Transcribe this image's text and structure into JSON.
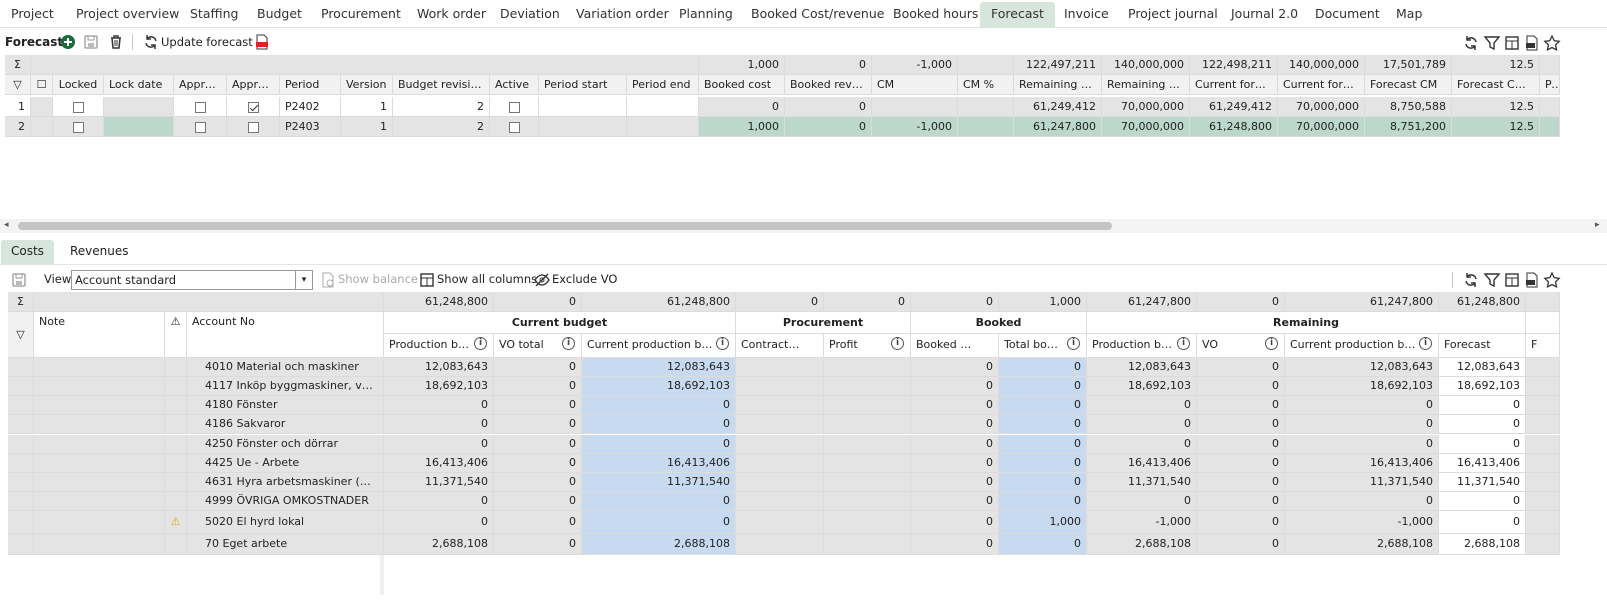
{
  "tabs": [
    "Project",
    "Project overview",
    "Staffing",
    "Budget",
    "Procurement",
    "Work order",
    "Deviation",
    "Variation order",
    "Planning",
    "Booked Cost/revenue",
    "Booked hours",
    "Forecast",
    "Invoice",
    "Project journal",
    "Journal 2.0",
    "Document",
    "Map"
  ],
  "active_tab": "Forecast",
  "forecast_toolbar": {
    "title": "Forecast",
    "update_label": "Update forecast"
  },
  "forecast_grid": {
    "totals": [
      "1,000",
      "0",
      "-1,000",
      "",
      "122,497,211",
      "140,000,000",
      "122,498,211",
      "140,000,000",
      "17,501,789",
      "12.5"
    ],
    "headers": [
      "Locked",
      "Lock date",
      "Appro...",
      "Appro...",
      "Period",
      "Version",
      "Budget revision",
      "Active",
      "Period start",
      "Period end",
      "Booked cost",
      "Booked reven...",
      "CM",
      "CM %",
      "Remaining cost",
      "Remaining rev...",
      "Current forec...",
      "Current forec...",
      "Forecast CM",
      "Forecast CM %",
      "Pe"
    ],
    "rows": [
      {
        "num": "1",
        "locked": false,
        "appr1": false,
        "appr2": true,
        "period": "P2402",
        "version": "1",
        "revision": "2",
        "active": false,
        "booked_cost": "0",
        "booked_rev": "0",
        "cm": "",
        "cm_pct": "",
        "rem_cost": "61,249,412",
        "rem_rev": "70,000,000",
        "cur_f1": "61,249,412",
        "cur_f2": "70,000,000",
        "f_cm": "8,750,588",
        "f_cm_pct": "12.5"
      },
      {
        "num": "2",
        "locked": false,
        "appr1": false,
        "appr2": false,
        "period": "P2403",
        "version": "1",
        "revision": "2",
        "active": false,
        "booked_cost": "1,000",
        "booked_rev": "0",
        "cm": "-1,000",
        "cm_pct": "",
        "rem_cost": "61,247,800",
        "rem_rev": "70,000,000",
        "cur_f1": "61,248,800",
        "cur_f2": "70,000,000",
        "f_cm": "8,751,200",
        "f_cm_pct": "12.5"
      }
    ]
  },
  "sub_tabs": [
    "Costs",
    "Revenues"
  ],
  "costs_toolbar": {
    "view_label": "View:",
    "view_value": "Account standard",
    "show_balance": "Show balance",
    "show_all_columns": "Show all columns",
    "exclude_vo": "Exclude VO"
  },
  "costs_grid": {
    "totals": [
      "61,248,800",
      "0",
      "61,248,800",
      "0",
      "0",
      "0",
      "1,000",
      "61,247,800",
      "0",
      "61,247,800",
      "61,248,800"
    ],
    "left_headers": {
      "note": "Note",
      "account": "Account No"
    },
    "groups": [
      "Current budget",
      "Procurement",
      "Booked",
      "Remaining"
    ],
    "headers": [
      "Production bu...",
      "VO total",
      "Current production bud...",
      "Contract ...",
      "Profit",
      "Booked VO",
      "Total book...",
      "Production bu...",
      "VO",
      "Current production bud...",
      "Forecast",
      "Forec"
    ],
    "rows": [
      {
        "warn": false,
        "account": "4010 Material och maskiner",
        "v": [
          "12,083,643",
          "0",
          "12,083,643",
          "",
          "",
          "0",
          "0",
          "12,083,643",
          "0",
          "12,083,643",
          "12,083,643"
        ]
      },
      {
        "warn": false,
        "account": "4117 Inköp byggmaskiner, ver...",
        "v": [
          "18,692,103",
          "0",
          "18,692,103",
          "",
          "",
          "0",
          "0",
          "18,692,103",
          "0",
          "18,692,103",
          "18,692,103"
        ]
      },
      {
        "warn": false,
        "account": "4180 Fönster",
        "v": [
          "0",
          "0",
          "0",
          "",
          "",
          "0",
          "0",
          "0",
          "0",
          "0",
          "0"
        ]
      },
      {
        "warn": false,
        "account": "4186 Sakvaror",
        "v": [
          "0",
          "0",
          "0",
          "",
          "",
          "0",
          "0",
          "0",
          "0",
          "0",
          "0"
        ]
      },
      {
        "warn": false,
        "account": "4250 Fönster och dörrar",
        "v": [
          "0",
          "0",
          "0",
          "",
          "",
          "0",
          "0",
          "0",
          "0",
          "0",
          "0"
        ]
      },
      {
        "warn": false,
        "account": "4425 Ue - Arbete",
        "v": [
          "16,413,406",
          "0",
          "16,413,406",
          "",
          "",
          "0",
          "0",
          "16,413,406",
          "0",
          "16,413,406",
          "16,413,406"
        ]
      },
      {
        "warn": false,
        "account": "4631 Hyra arbetsmaskiner (m...",
        "v": [
          "11,371,540",
          "0",
          "11,371,540",
          "",
          "",
          "0",
          "0",
          "11,371,540",
          "0",
          "11,371,540",
          "11,371,540"
        ]
      },
      {
        "warn": false,
        "account": "4999 ÖVRIGA OMKOSTNADER",
        "v": [
          "0",
          "0",
          "0",
          "",
          "",
          "0",
          "0",
          "0",
          "0",
          "0",
          "0"
        ]
      },
      {
        "warn": true,
        "account": "5020 El hyrd lokal",
        "v": [
          "0",
          "0",
          "0",
          "",
          "",
          "0",
          "1,000",
          "-1,000",
          "0",
          "-1,000",
          "0"
        ]
      },
      {
        "warn": false,
        "account": "70 Eget arbete",
        "v": [
          "2,688,108",
          "0",
          "2,688,108",
          "",
          "",
          "0",
          "0",
          "2,688,108",
          "0",
          "2,688,108",
          "2,688,108"
        ]
      }
    ]
  },
  "icons": [
    "plus-circle-icon",
    "save-icon",
    "trash-icon",
    "refresh-icon",
    "pdf-icon",
    "filter-icon",
    "excel-icon",
    "star-icon",
    "sigma-icon",
    "warning-icon",
    "info-icon",
    "columns-icon",
    "eye-off-icon"
  ]
}
